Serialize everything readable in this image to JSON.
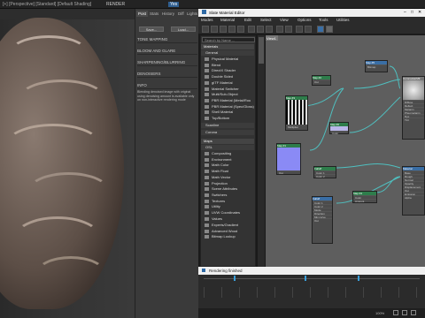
{
  "viewport": {
    "label": "[+] [Perspective] [Standard] [Default Shading]",
    "render_label": "RENDER"
  },
  "top_tabs": {
    "yes_label": "Yes"
  },
  "mid_panel": {
    "tabs": [
      "Post",
      "Stats",
      "History",
      "Diff",
      "Lights"
    ],
    "save_label": "Save...",
    "load_label": "Load...",
    "sections": [
      "TONE MAPPING",
      "BLOOM AND GLARE",
      "SHARPENING/BLURRING",
      "DENOISERS",
      "INFO"
    ],
    "info_text": "Blending denoised image with original using denoising amount is available only on non-interactive rendering mode"
  },
  "slate": {
    "title": "Slate Material Editor",
    "menu": [
      "Modes",
      "Material",
      "Edit",
      "Select",
      "View",
      "Options",
      "Tools",
      "Utilities"
    ],
    "view_tab": "View1",
    "search_placeholder": "Search by Name ...",
    "status_text": "Rendering finished",
    "zoom_value": "100%"
  },
  "browser": {
    "materials_header": "Materials",
    "general_header": "General",
    "general_items": [
      "Physical Material",
      "Blend",
      "DirectX Shader",
      "Double Sided",
      "gITF Material",
      "Material Switcher",
      "Multi/Sub-Object",
      "PBR Material (Metal/Rou",
      "PBR Material (Spec/Gloss)",
      "Shell Material",
      "Top/Bottom",
      "XRef Material"
    ],
    "scanline_header": "Scanline",
    "corona_header": "Corona",
    "maps_header": "Maps",
    "osl_header": "OSL",
    "osl_items": [
      "Compositing",
      "Environment",
      "Math Color",
      "Math Float",
      "Math Vector",
      "Projection",
      "Scene Attributes",
      "Switchers",
      "Textures",
      "Utility",
      "UVW Coordinates",
      "Values"
    ],
    "map_items": [
      "Experts/Gradient",
      "Advanced Wood",
      "Bitmap Lookup"
    ]
  },
  "nodes": [
    {
      "title": "Map #5",
      "rows": [
        "Bitmap",
        "Color",
        "Out"
      ]
    },
    {
      "title": "CoronaHairMtl",
      "rows": [
        "Diffuse",
        "Reflect",
        "Melanin",
        "Pheomelanin",
        "Dye",
        "Tint"
      ]
    },
    {
      "title": "Map #2",
      "rows": [
        "Out"
      ]
    },
    {
      "title": "Map #3",
      "rows": [
        "Multiplier"
      ]
    },
    {
      "title": "Map #6",
      "rows": [
        "Color"
      ]
    },
    {
      "title": "Map #1",
      "rows": [
        "Out"
      ]
    },
    {
      "title": "Falloff",
      "rows": [
        "Color 1",
        "Color 2",
        "Mode",
        "Direction",
        "Mix curve",
        "Out"
      ]
    },
    {
      "title": "Map #4",
      "rows": [
        "Color",
        "Amount",
        "Out"
      ]
    },
    {
      "title": "Material",
      "rows": [
        "Base",
        "Rough",
        "Normal",
        "Opacity",
        "Displacement",
        "Out",
        "Emission",
        "Alpha"
      ]
    }
  ],
  "colors": {
    "accent": "#3a6ea5",
    "node_green": "#2e7d4b",
    "node_link": "#4fbfbf",
    "graph_bg": "#5e5e5e"
  }
}
